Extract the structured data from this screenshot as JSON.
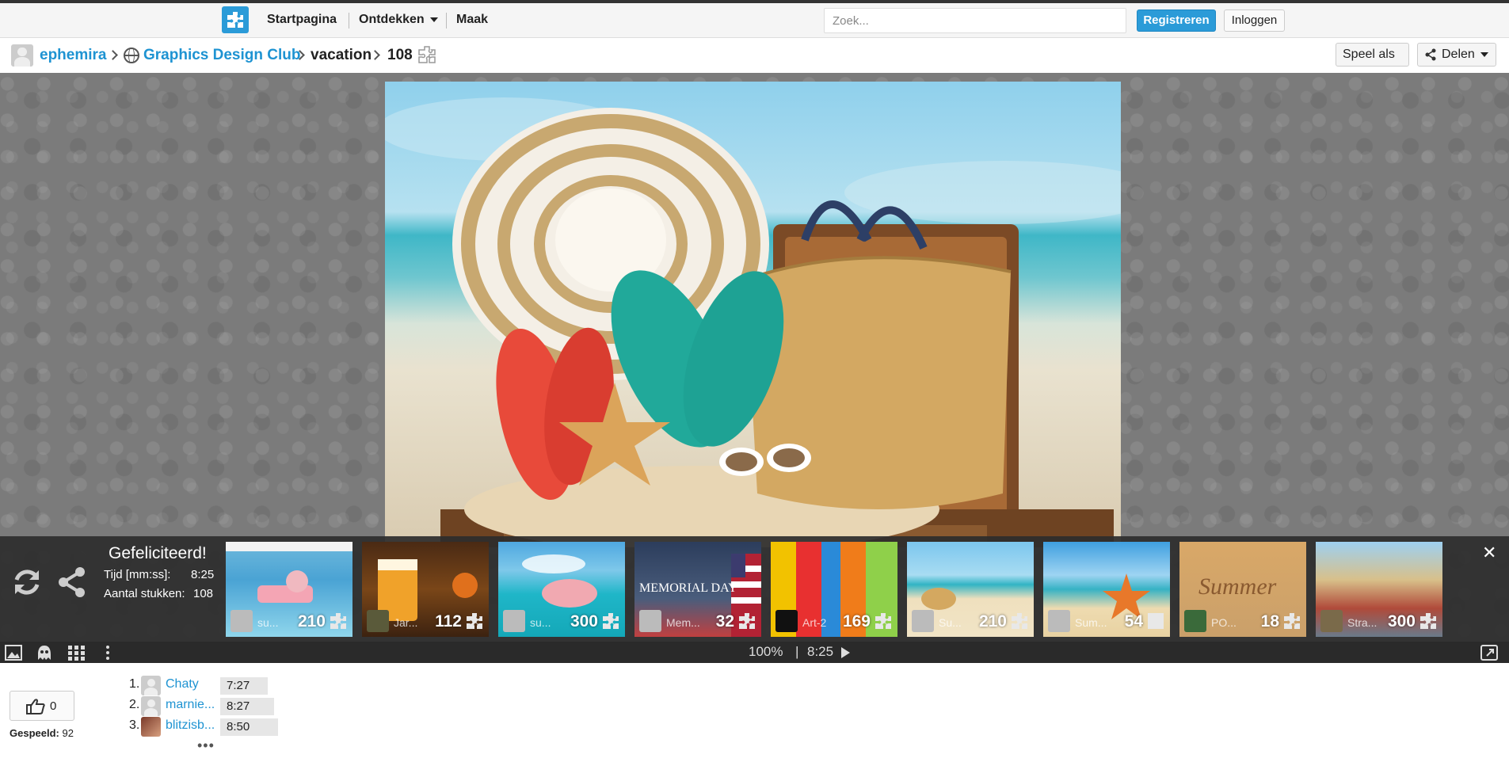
{
  "nav": {
    "home": "Startpagina",
    "discover": "Ontdekken",
    "create": "Maak",
    "search_placeholder": "Zoek...",
    "register": "Registreren",
    "login": "Inloggen"
  },
  "breadcrumb": {
    "user": "ephemira",
    "club": "Graphics Design Club",
    "album": "vacation",
    "pieces": "108",
    "play_as": "Speel als",
    "share": "Delen"
  },
  "result": {
    "congrats": "Gefeliciteerd!",
    "time_label": "Tijd [mm:ss]:",
    "time_value": "8:25",
    "pieces_label": "Aantal stukken:",
    "pieces_value": "108"
  },
  "thumbnails": [
    {
      "owner": "su...",
      "count": "210",
      "theme": "pool"
    },
    {
      "owner": "Jar...",
      "count": "112",
      "theme": "beer"
    },
    {
      "owner": "su...",
      "count": "300",
      "theme": "pig-sea"
    },
    {
      "owner": "Mem...",
      "count": "32",
      "theme": "memorial"
    },
    {
      "owner": "Art-2",
      "count": "169",
      "theme": "colorful-street"
    },
    {
      "owner": "Su...",
      "count": "210",
      "theme": "beach"
    },
    {
      "owner": "Sum...",
      "count": "54",
      "theme": "starfish"
    },
    {
      "owner": "PO...",
      "count": "18",
      "theme": "sand-summer"
    },
    {
      "owner": "Stra...",
      "count": "300",
      "theme": "town"
    }
  ],
  "memorial_caption": "MEMORIAL DAY",
  "summer_caption": "Summer",
  "controls": {
    "zoom": "100%",
    "separator": "|",
    "timer": "8:25"
  },
  "social": {
    "likes": "0",
    "played_label": "Gespeeld:",
    "played_value": "92"
  },
  "leaderboard": [
    {
      "rank": "1.",
      "name": "Chaty",
      "time": "7:27"
    },
    {
      "rank": "2.",
      "name": "marnie...",
      "time": "8:27"
    },
    {
      "rank": "3.",
      "name": "blitzisb...",
      "time": "8:50"
    }
  ],
  "leaderboard_more": "•••",
  "colors": {
    "accent": "#2b9bd8",
    "link": "#1e93d2",
    "stage_bg": "#7b7b7b",
    "overlay_bg": "#2d2d2d"
  }
}
